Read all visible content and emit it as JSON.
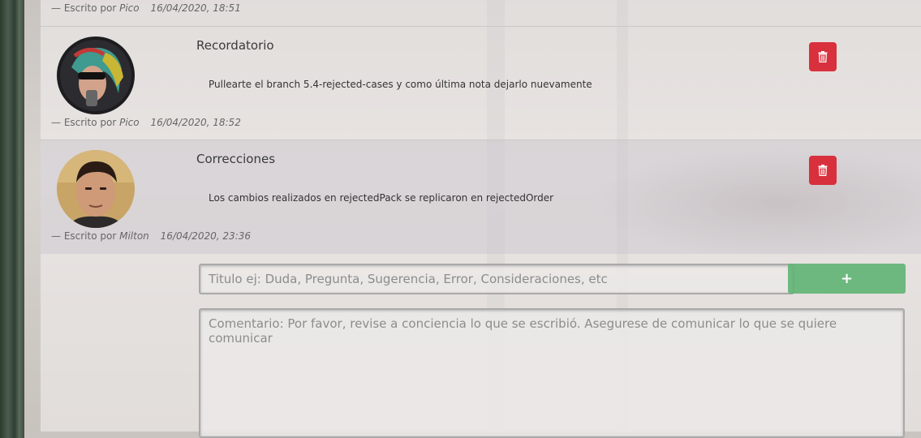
{
  "top_signature": {
    "prefix": "— Escrito por",
    "author": "Pico",
    "date": "16/04/2020, 18:51"
  },
  "comments": [
    {
      "title": "Recordatorio",
      "text": "Pullearte el branch 5.4-rejected-cases y como última nota dejarlo nuevamente",
      "signature_prefix": "— Escrito por",
      "author": "Pico",
      "date": "16/04/2020, 18:52"
    },
    {
      "title": "Correcciones",
      "text": "Los cambios realizados en rejectedPack se replicaron en rejectedOrder",
      "signature_prefix": "— Escrito por",
      "author": "Milton",
      "date": "16/04/2020, 23:36"
    }
  ],
  "form": {
    "title_placeholder": "Titulo ej: Duda, Pregunta, Sugerencia, Error, Consideraciones, etc",
    "title_value": "",
    "add_label": "+",
    "comment_placeholder": "Comentario: Por favor, revise a conciencia lo que se escribió. Asegurese de comunicar lo que se quiere comunicar",
    "comment_value": ""
  },
  "icons": {
    "delete": "trash-icon",
    "avatar": "avatar"
  },
  "colors": {
    "delete": "#d9303e",
    "add": "#5fb474"
  }
}
